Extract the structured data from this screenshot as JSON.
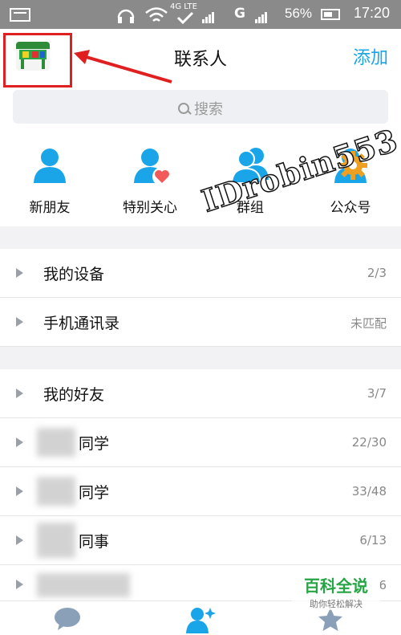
{
  "status_bar": {
    "network": "4G LTE",
    "g_label": "G",
    "battery": "56%",
    "time": "17:20"
  },
  "header": {
    "title": "联系人",
    "add": "添加"
  },
  "search": {
    "placeholder": "搜索"
  },
  "quick_actions": [
    {
      "label": "新朋友",
      "icon": "new-friend-icon"
    },
    {
      "label": "特别关心",
      "icon": "special-care-icon"
    },
    {
      "label": "群组",
      "icon": "group-icon"
    },
    {
      "label": "公众号",
      "icon": "official-account-icon"
    }
  ],
  "section1": [
    {
      "label": "我的设备",
      "count": "2/3"
    },
    {
      "label": "手机通讯录",
      "count": "未匹配"
    }
  ],
  "section2": [
    {
      "label": "我的好友",
      "count": "3/7"
    },
    {
      "label": "同学",
      "count": "22/30"
    },
    {
      "label": "同学",
      "count": "33/48"
    },
    {
      "label": "同事",
      "count": "6/13"
    },
    {
      "label": "",
      "count": "6"
    }
  ],
  "overlays": {
    "watermark": "IDrobin553",
    "baike_title": "百科全说",
    "baike_sub": "助你轻松解决"
  },
  "colors": {
    "accent": "#1aa5e8",
    "highlight": "#e02020"
  }
}
